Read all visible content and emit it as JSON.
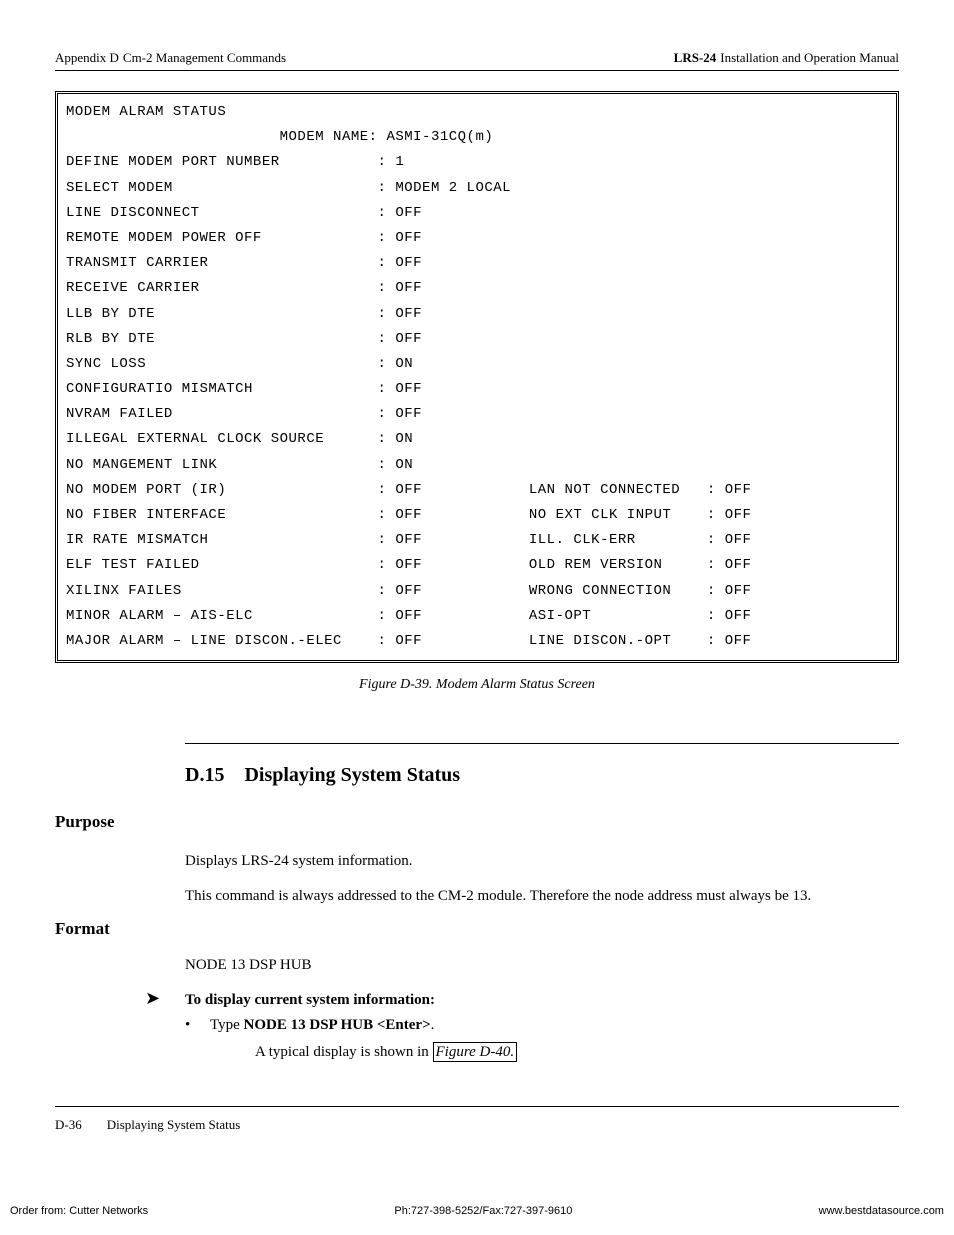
{
  "header": {
    "appendix": "Appendix D",
    "appendixTitle": "Cm-2 Management Commands",
    "product": "LRS-24",
    "manual": "Installation and Operation Manual"
  },
  "terminal": {
    "title": "MODEM ALRAM STATUS",
    "modemNameLabel": "MODEM NAME:",
    "modemNameValue": "ASMI-31CQ(m)",
    "rows": [
      {
        "l": "DEFINE MODEM PORT NUMBER",
        "v": "1",
        "r": "",
        "rv": ""
      },
      {
        "l": "SELECT MODEM",
        "v": "MODEM 2 LOCAL",
        "r": "",
        "rv": ""
      },
      {
        "l": "LINE DISCONNECT",
        "v": "OFF",
        "r": "",
        "rv": ""
      },
      {
        "l": "REMOTE MODEM POWER OFF",
        "v": "OFF",
        "r": "",
        "rv": ""
      },
      {
        "l": "TRANSMIT CARRIER",
        "v": "OFF",
        "r": "",
        "rv": ""
      },
      {
        "l": "RECEIVE CARRIER",
        "v": "OFF",
        "r": "",
        "rv": ""
      },
      {
        "l": "LLB BY DTE",
        "v": "OFF",
        "r": "",
        "rv": ""
      },
      {
        "l": "RLB BY DTE",
        "v": "OFF",
        "r": "",
        "rv": ""
      },
      {
        "l": "SYNC LOSS",
        "v": "ON",
        "r": "",
        "rv": ""
      },
      {
        "l": "CONFIGURATIO MISMATCH",
        "v": "OFF",
        "r": "",
        "rv": ""
      },
      {
        "l": "NVRAM FAILED",
        "v": "OFF",
        "r": "",
        "rv": ""
      },
      {
        "l": "ILLEGAL EXTERNAL CLOCK SOURCE",
        "v": "ON",
        "r": "",
        "rv": ""
      },
      {
        "l": "NO MANGEMENT LINK",
        "v": "ON",
        "r": "",
        "rv": ""
      },
      {
        "l": "NO MODEM PORT (IR)",
        "v": "OFF",
        "r": "LAN NOT CONNECTED",
        "rv": "OFF"
      },
      {
        "l": "NO FIBER INTERFACE",
        "v": "OFF",
        "r": "NO EXT CLK INPUT",
        "rv": "OFF"
      },
      {
        "l": "IR RATE MISMATCH",
        "v": "OFF",
        "r": "ILL. CLK-ERR",
        "rv": "OFF"
      },
      {
        "l": "ELF TEST FAILED",
        "v": "OFF",
        "r": "OLD REM VERSION",
        "rv": "OFF"
      },
      {
        "l": "XILINX FAILES",
        "v": "OFF",
        "r": "WRONG CONNECTION",
        "rv": "OFF"
      },
      {
        "l": "MINOR ALARM – AIS-ELC",
        "v": "OFF",
        "r": "ASI-OPT",
        "rv": "OFF"
      },
      {
        "l": "MAJOR ALARM – LINE DISCON.-ELEC",
        "v": "OFF",
        "r": "LINE DISCON.-OPT",
        "rv": "OFF"
      }
    ]
  },
  "figureCaption": "Figure D-39.  Modem Alarm Status Screen",
  "section": {
    "number": "D.15",
    "title": "Displaying System Status"
  },
  "purpose": {
    "heading": "Purpose",
    "p1": "Displays LRS-24 system information.",
    "p2": "This command is always addressed to the CM-2 module. Therefore the node address must always be 13."
  },
  "format": {
    "heading": "Format",
    "cmd": "NODE 13 DSP HUB",
    "arrowText": "To display current system information:",
    "bulletPrefix": "Type ",
    "bulletBold": "NODE 13 DSP HUB <Enter>",
    "bulletSuffix": ".",
    "typicalPrefix": "A typical display is shown in ",
    "figref": "Figure D-40."
  },
  "footer": {
    "pageNum": "D-36",
    "pageTitle": "Displaying System Status"
  },
  "bottom": {
    "left": "Order from: Cutter Networks",
    "center": "Ph:727-398-5252/Fax:727-397-9610",
    "right": "www.bestdatasource.com"
  }
}
